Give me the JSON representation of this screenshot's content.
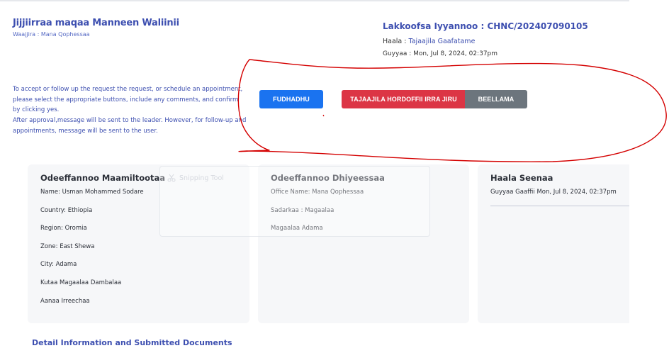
{
  "header": {
    "title": "Jijjiirraa maqaa Manneen Waliinii",
    "subtitle": "Waajjira : Mana Qophessaa",
    "request_number": "Lakkoofsa Iyyannoo : CHNC/202407090105",
    "status_label": "Haala : ",
    "status_value": "Tajaajila Gaafatame",
    "date": "Guyyaa : Mon, Jul 8, 2024, 02:37pm"
  },
  "instructions": {
    "line1": "To accept or follow up the request the request, or schedule an appointment, please select the appropriate buttons, include any comments, and confirm by clicking yes.",
    "line2": "After approval,message will be sent to the leader. However, for follow-up and appointments, message will be sent to the user."
  },
  "actions": {
    "accept": "FUDHADHU",
    "reject": "TAJAAJILA HORDOFFII IRRA JIRU",
    "appointment": "BEELLAMA"
  },
  "applicant": {
    "title": "Odeeffannoo Maamiltootaa",
    "name": "Name: Usman Mohammed Sodare",
    "country": "Country: Ethiopia",
    "region": "Region: Oromia",
    "zone": "Zone: East Shewa",
    "city": "City: Adama",
    "kutaa": "Kutaa Magaalaa Dambalaa",
    "aanaa": "Aanaa Irreechaa"
  },
  "office": {
    "title": "Odeeffannoo Dhiyeessaa",
    "office_name": "Office Name: Mana Qophessaa",
    "sadarkaa": "Sadarkaa : Magaalaa",
    "city": "Magaalaa Adama"
  },
  "status_card": {
    "title": "Haala Seenaa",
    "date": "Guyyaa Gaaffii Mon, Jul 8, 2024, 02:37pm"
  },
  "snipping_tool": {
    "label": "Snipping Tool"
  },
  "details": {
    "title": "Detail Information and Submitted Documents"
  },
  "colors": {
    "primary": "#1a73f0",
    "danger": "#dc3545",
    "secondary": "#6c757d",
    "heading": "#3d4fb0",
    "annotation": "#d40000"
  }
}
